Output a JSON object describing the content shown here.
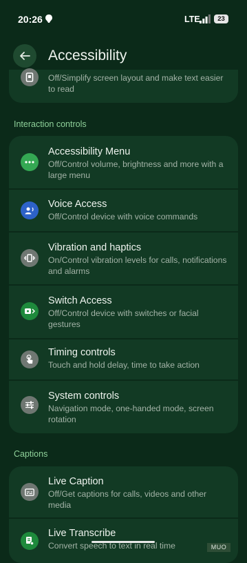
{
  "status": {
    "time": "20:26",
    "network": "LTE",
    "battery": "23"
  },
  "header": {
    "title": "Accessibility"
  },
  "top_item": {
    "subtitle": "Off/Simplify screen layout and make text easier to read"
  },
  "sections": [
    {
      "label": "Interaction controls",
      "items": [
        {
          "title": "Accessibility Menu",
          "subtitle": "Off/Control volume, brightness and more with a large menu",
          "icon": "more-dots-icon",
          "icon_color": "#34a853"
        },
        {
          "title": "Voice Access",
          "subtitle": "Off/Control device with voice commands",
          "icon": "voice-access-icon",
          "icon_color": "#2d62c8"
        },
        {
          "title": "Vibration and haptics",
          "subtitle": "On/Control vibration levels for calls, notifications and alarms",
          "icon": "vibration-icon",
          "icon_color": "#6f7772"
        },
        {
          "title": "Switch Access",
          "subtitle": "Off/Control device with switches or facial gestures",
          "icon": "switch-access-icon",
          "icon_color": "#1e8a3c"
        },
        {
          "title": "Timing controls",
          "subtitle": "Touch and hold delay, time to take action",
          "icon": "touch-hand-icon",
          "icon_color": "#6f7772"
        },
        {
          "title": "System controls",
          "subtitle": "Navigation mode, one-handed mode, screen rotation",
          "icon": "sliders-icon",
          "icon_color": "#6f7772"
        }
      ]
    },
    {
      "label": "Captions",
      "items": [
        {
          "title": "Live Caption",
          "subtitle": "Off/Get captions for calls, videos and other media",
          "icon": "captions-icon",
          "icon_color": "#6f7772"
        },
        {
          "title": "Live Transcribe",
          "subtitle": "Convert speech to text in real time",
          "icon": "transcribe-icon",
          "icon_color": "#1e8a3c"
        }
      ]
    }
  ],
  "watermark": "MUO"
}
